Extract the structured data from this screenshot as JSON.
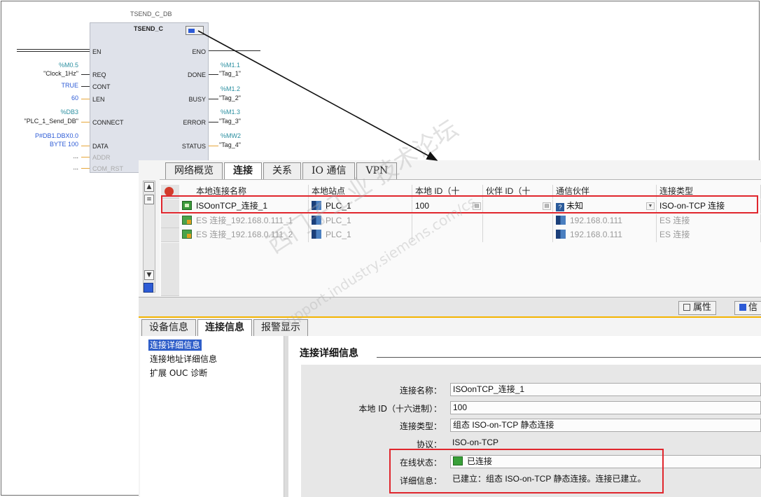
{
  "fb": {
    "instance_db": "TSEND_C_DB",
    "block_name": "TSEND_C",
    "inputs": [
      {
        "pin": "EN",
        "addr": "",
        "value": ""
      },
      {
        "pin": "REQ",
        "addr": "%M0.5",
        "value": "\"Clock_1Hz\""
      },
      {
        "pin": "CONT",
        "addr": "",
        "value": "TRUE"
      },
      {
        "pin": "LEN",
        "addr": "",
        "value": "60"
      },
      {
        "pin": "CONNECT",
        "addr": "%DB3",
        "value": "\"PLC_1_Send_DB\""
      },
      {
        "pin": "DATA",
        "addr": "P#DB1.DBX0.0",
        "value": "BYTE 100"
      },
      {
        "pin": "ADDR",
        "addr": "",
        "value": "..."
      },
      {
        "pin": "COM_RST",
        "addr": "",
        "value": "..."
      }
    ],
    "outputs": [
      {
        "pin": "ENO",
        "addr": "",
        "value": ""
      },
      {
        "pin": "DONE",
        "addr": "%M1.1",
        "value": "\"Tag_1\""
      },
      {
        "pin": "BUSY",
        "addr": "%M1.2",
        "value": "\"Tag_2\""
      },
      {
        "pin": "ERROR",
        "addr": "%M1.3",
        "value": "\"Tag_3\""
      },
      {
        "pin": "STATUS",
        "addr": "%MW2",
        "value": "\"Tag_4\""
      }
    ]
  },
  "top_tabs": [
    "网络概览",
    "连接",
    "关系",
    "IO 通信",
    "VPN"
  ],
  "grid": {
    "headers": [
      "本地连接名称",
      "本地站点",
      "本地 ID（十",
      "伙伴 ID（十",
      "通信伙伴",
      "连接类型"
    ],
    "rows": [
      {
        "name": "ISOonTCP_连接_1",
        "station": "PLC_1",
        "local_id": "100",
        "partner_id": "",
        "partner": "未知",
        "type": "ISO-on-TCP 连接"
      },
      {
        "name": "ES 连接_192.168.0.111_1",
        "station": "PLC_1",
        "local_id": "",
        "partner_id": "",
        "partner": "192.168.0.111",
        "type": "ES 连接"
      },
      {
        "name": "ES 连接_192.168.0.111_2",
        "station": "PLC_1",
        "local_id": "",
        "partner_id": "",
        "partner": "192.168.0.111",
        "type": "ES 连接"
      }
    ]
  },
  "inspector": {
    "properties_button": "属性",
    "info_button": "信",
    "tabs": [
      "设备信息",
      "连接信息",
      "报警显示"
    ],
    "nav": [
      "连接详细信息",
      "连接地址详细信息",
      "扩展 OUC 诊断"
    ],
    "section_title": "连接详细信息",
    "fields": [
      {
        "label": "连接名称：",
        "value": "ISOonTCP_连接_1"
      },
      {
        "label": "本地 ID（十六进制）：",
        "value": "100"
      },
      {
        "label": "连接类型：",
        "value": "组态 ISO-on-TCP 静态连接"
      },
      {
        "label": "协议：",
        "value": "ISO-on-TCP"
      },
      {
        "label": "在线状态：",
        "value": "已连接"
      },
      {
        "label": "详细信息：",
        "value": "已建立：组态 ISO-on-TCP 静态连接。连接已建立。"
      }
    ]
  },
  "watermark": {
    "line1": "西门子工业  技术论坛",
    "line2": "support.industry.siemens.com/cs"
  },
  "colors": {
    "highlight_red": "#e0262d",
    "accent_orange": "#f4b400",
    "selection_blue": "#2f5ec9"
  }
}
